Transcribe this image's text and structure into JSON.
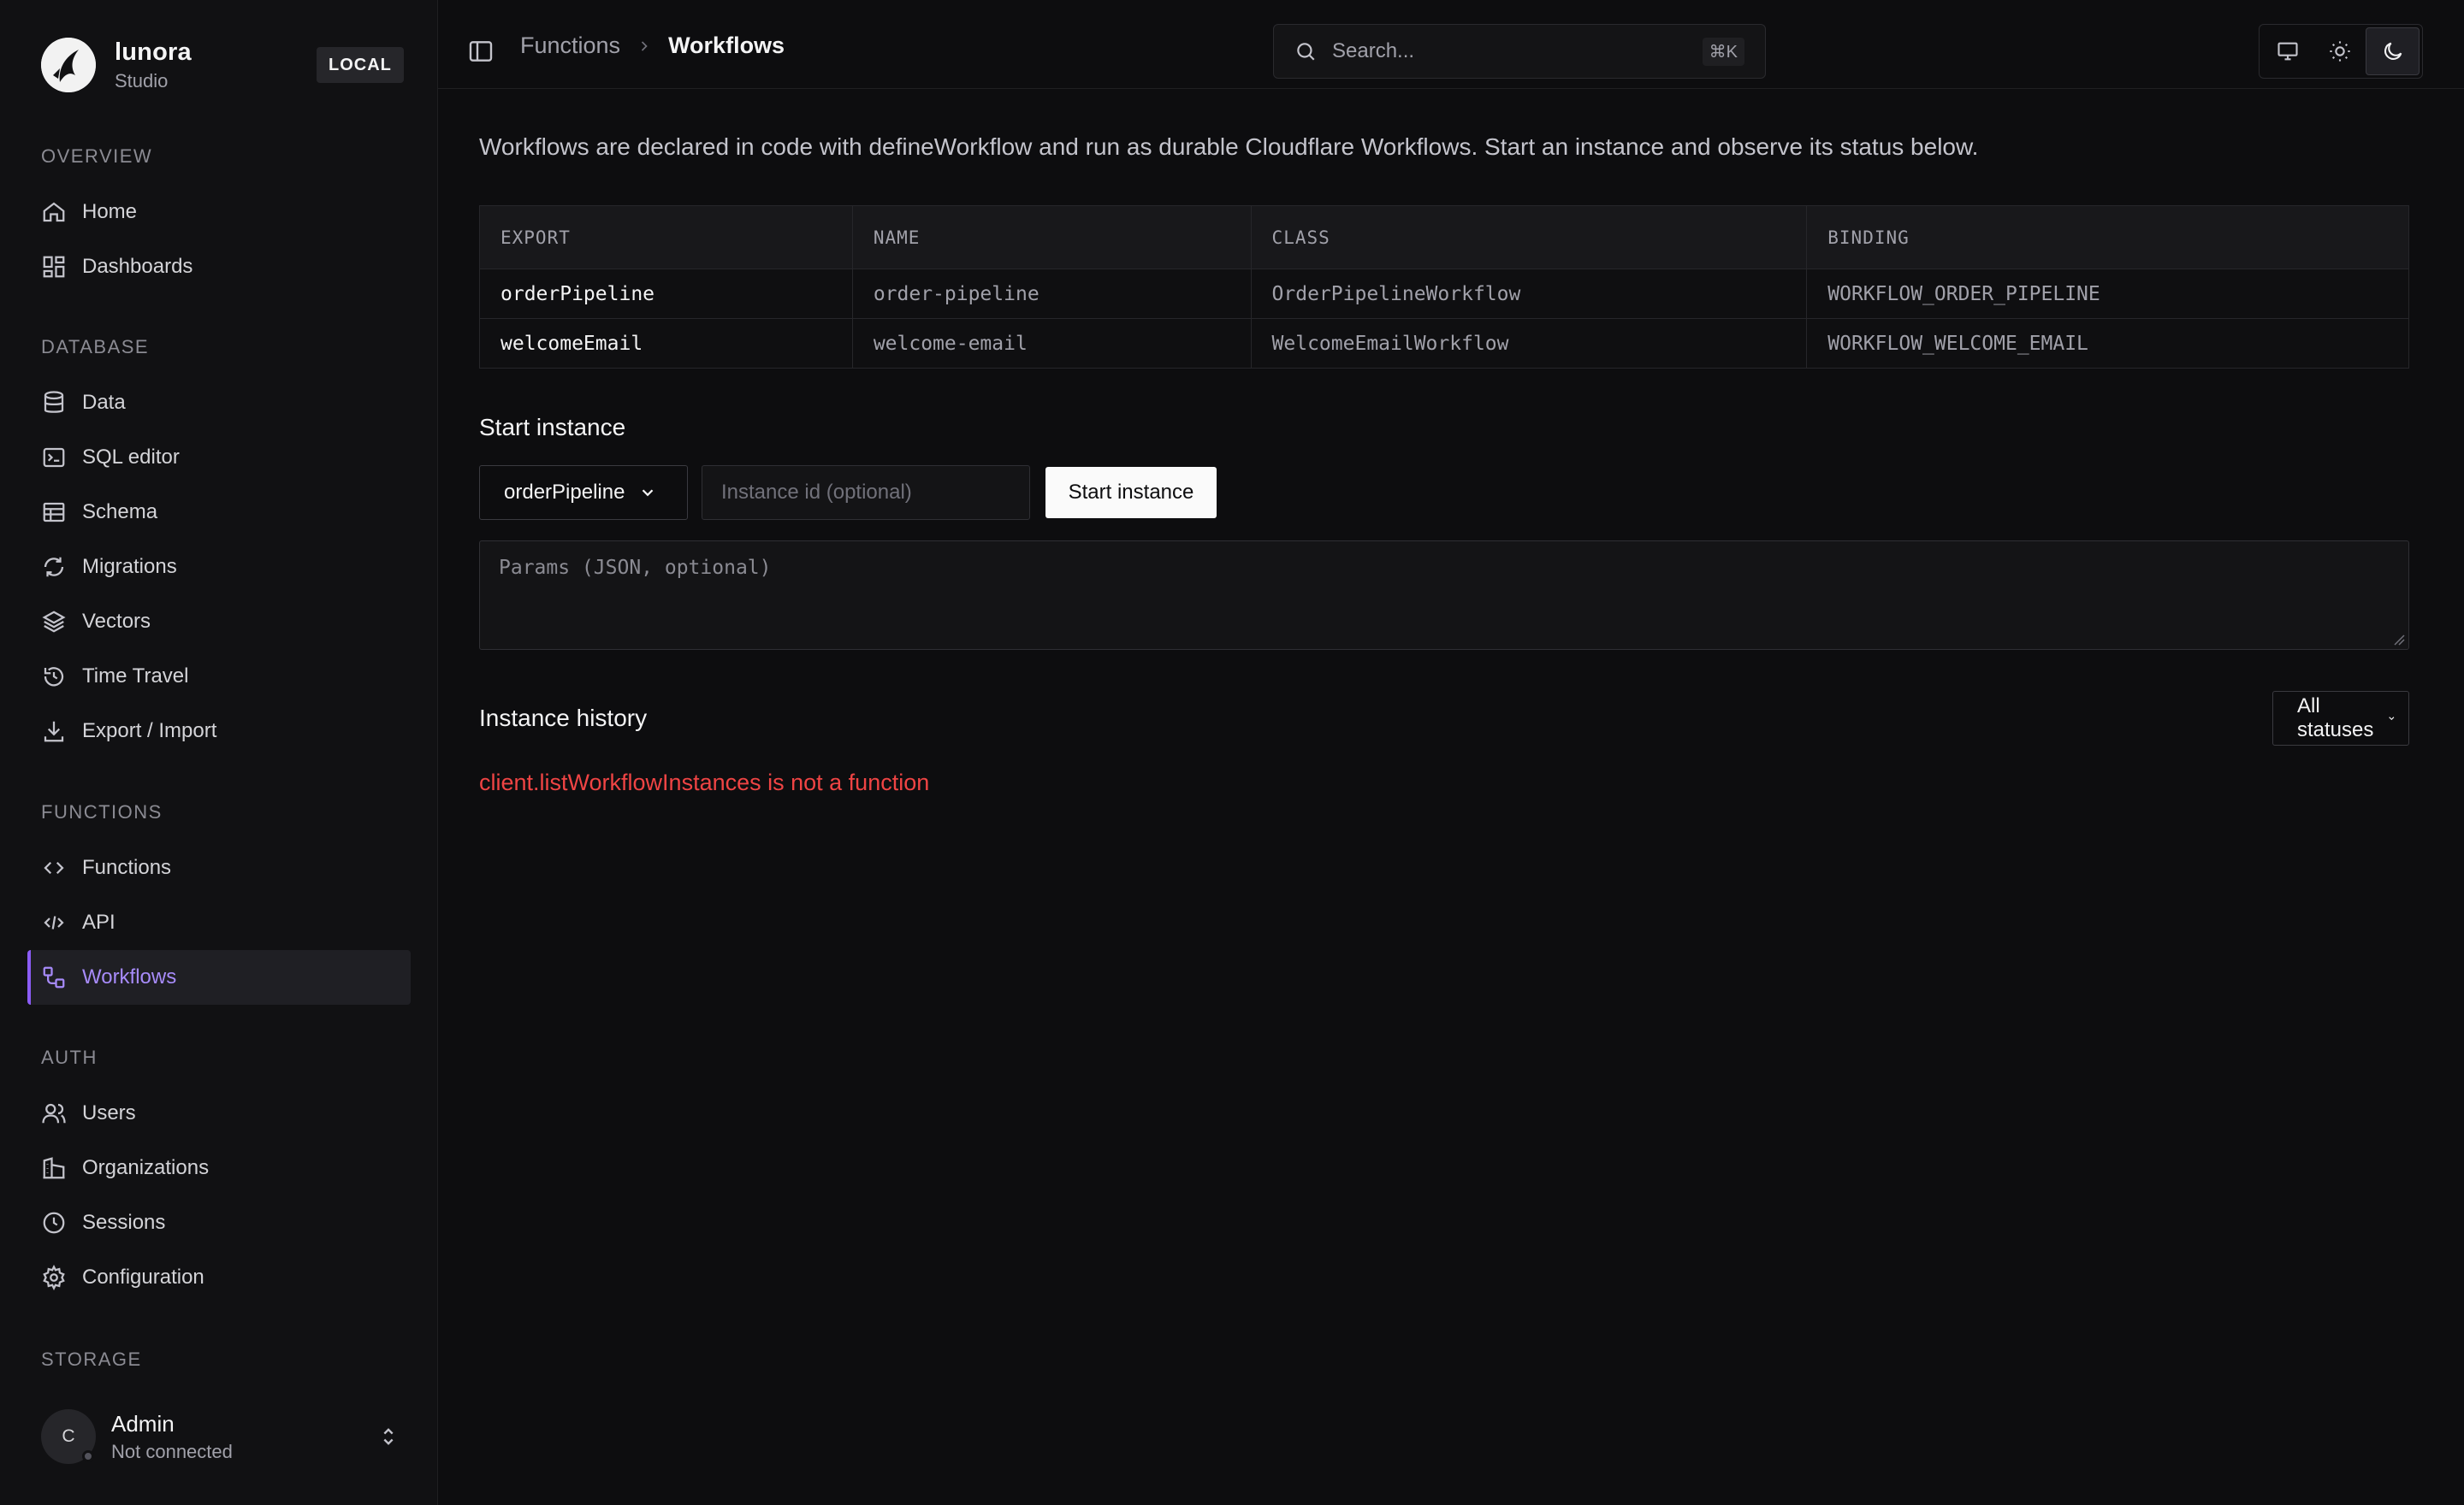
{
  "brand": {
    "name": "lunora",
    "subtitle": "Studio",
    "env_badge": "LOCAL"
  },
  "sidebar": {
    "sections": [
      {
        "label": "OVERVIEW",
        "items": [
          {
            "label": "Home",
            "icon": "home-icon"
          },
          {
            "label": "Dashboards",
            "icon": "dashboard-icon"
          }
        ]
      },
      {
        "label": "DATABASE",
        "items": [
          {
            "label": "Data",
            "icon": "database-icon"
          },
          {
            "label": "SQL editor",
            "icon": "terminal-icon"
          },
          {
            "label": "Schema",
            "icon": "table-icon"
          },
          {
            "label": "Migrations",
            "icon": "refresh-icon"
          },
          {
            "label": "Vectors",
            "icon": "layers-icon"
          },
          {
            "label": "Time Travel",
            "icon": "history-icon"
          },
          {
            "label": "Export / Import",
            "icon": "download-icon"
          }
        ]
      },
      {
        "label": "FUNCTIONS",
        "items": [
          {
            "label": "Functions",
            "icon": "code-icon"
          },
          {
            "label": "API",
            "icon": "code-xml-icon"
          },
          {
            "label": "Workflows",
            "icon": "workflow-icon",
            "active": true
          }
        ]
      },
      {
        "label": "AUTH",
        "items": [
          {
            "label": "Users",
            "icon": "users-icon"
          },
          {
            "label": "Organizations",
            "icon": "building-icon"
          },
          {
            "label": "Sessions",
            "icon": "clock-icon"
          },
          {
            "label": "Configuration",
            "icon": "gear-icon"
          }
        ]
      },
      {
        "label": "STORAGE",
        "items": []
      }
    ],
    "user": {
      "initial": "C",
      "name": "Admin",
      "status": "Not connected"
    }
  },
  "topbar": {
    "breadcrumb": {
      "parent": "Functions",
      "current": "Workflows"
    },
    "search": {
      "placeholder": "Search...",
      "shortcut": "⌘K"
    },
    "theme": {
      "options": [
        "system",
        "light",
        "dark"
      ],
      "selected": "dark"
    }
  },
  "main": {
    "intro": "Workflows are declared in code with defineWorkflow and run as durable Cloudflare Workflows. Start an instance and observe its status below.",
    "table": {
      "columns": [
        "EXPORT",
        "NAME",
        "CLASS",
        "BINDING"
      ],
      "rows": [
        [
          "orderPipeline",
          "order-pipeline",
          "OrderPipelineWorkflow",
          "WORKFLOW_ORDER_PIPELINE"
        ],
        [
          "welcomeEmail",
          "welcome-email",
          "WelcomeEmailWorkflow",
          "WORKFLOW_WELCOME_EMAIL"
        ]
      ]
    },
    "start": {
      "title": "Start instance",
      "workflow_select": "orderPipeline",
      "instance_id_placeholder": "Instance id (optional)",
      "button_label": "Start instance",
      "params_placeholder": "Params (JSON, optional)"
    },
    "history": {
      "title": "Instance history",
      "status_filter": "All statuses",
      "error": "client.listWorkflowInstances is not a function"
    }
  },
  "colors": {
    "accent": "#8b5cf6",
    "error": "#ef4444",
    "background": "#0d0d0f"
  }
}
